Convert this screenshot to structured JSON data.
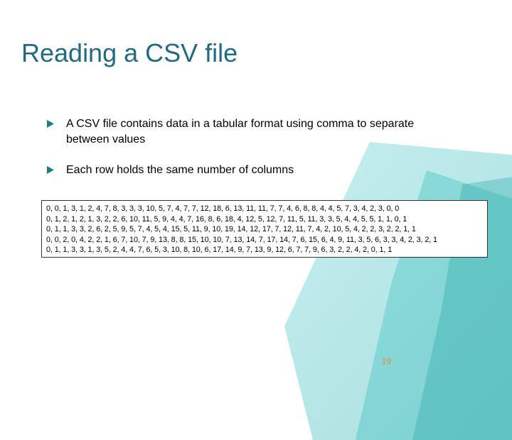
{
  "title": "Reading a CSV file",
  "bullets": [
    "A CSV file contains data in a tabular format using comma to separate between values",
    "Each row holds the same number of columns"
  ],
  "csv_rows": [
    "0, 0, 1, 3, 1, 2, 4, 7, 8, 3, 3, 3, 10, 5, 7, 4, 7, 7, 12, 18, 6, 13, 11, 11, 7, 7, 4, 6, 8, 8, 4, 4, 5, 7, 3, 4, 2, 3, 0, 0",
    "0, 1, 2, 1, 2, 1, 3, 2, 2, 6, 10, 11, 5, 9, 4, 4, 7, 16, 8, 6, 18, 4, 12, 5, 12, 7, 11, 5, 11, 3, 3, 5, 4, 4, 5, 5, 1, 1, 0, 1",
    "0, 1, 1, 3, 3, 2, 6, 2, 5, 9, 5, 7, 4, 5, 4, 15, 5, 11, 9, 10, 19, 14, 12, 17, 7, 12, 11, 7, 4, 2, 10, 5, 4, 2, 2, 3, 2, 2, 1, 1",
    "0, 0, 2, 0, 4, 2, 2, 1, 6, 7, 10, 7, 9, 13, 8, 8, 15, 10, 10, 7, 13, 14, 7, 17, 14, 7, 6, 15, 6, 4, 9, 11, 3, 5, 6, 3, 3, 4, 2, 3, 2, 1",
    "0, 1, 1, 3, 3, 1, 3, 5, 2, 4, 4, 7, 6, 5, 3, 10, 8, 10, 6, 17, 14, 9, 7, 13, 9, 12, 6, 7, 7, 9, 6, 3, 2, 2, 4, 2, 0, 1, 1"
  ],
  "page_number": "19"
}
